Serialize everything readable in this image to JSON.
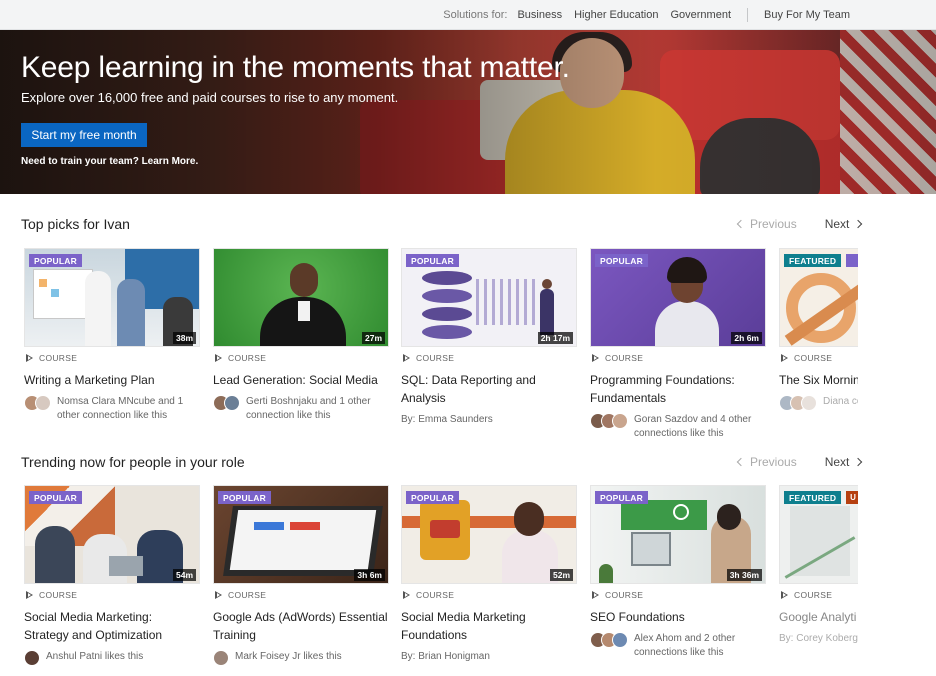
{
  "topbar": {
    "solutions_label": "Solutions for:",
    "links": [
      "Business",
      "Higher Education",
      "Government"
    ],
    "buy_label": "Buy For My Team"
  },
  "hero": {
    "headline": "Keep learning in the moments that matter.",
    "subheadline": "Explore over 16,000 free and paid courses to rise to any moment.",
    "cta_label": "Start my free month",
    "team_link": "Need to train your team? Learn More."
  },
  "pager": {
    "previous": "Previous",
    "next": "Next"
  },
  "sections": [
    {
      "title": "Top picks for Ivan",
      "cards": [
        {
          "badge": "POPULAR",
          "duration": "38m",
          "type": "COURSE",
          "title": "Writing a Marketing Plan",
          "meta": "Nomsa Clara MNcube and 1 other connection like this"
        },
        {
          "badge": "",
          "duration": "27m",
          "type": "COURSE",
          "title": "Lead Generation: Social Media",
          "meta": "Gerti Boshnjaku and 1 other connection like this"
        },
        {
          "badge": "POPULAR",
          "duration": "2h 17m",
          "type": "COURSE",
          "title": "SQL: Data Reporting and Analysis",
          "meta": "By: Emma Saunders"
        },
        {
          "badge": "POPULAR",
          "duration": "2h 6m",
          "type": "COURSE",
          "title": "Programming Foundations: Fundamentals",
          "meta": "Goran Sazdov and 4 other connections like this"
        },
        {
          "badge": "FEATURED",
          "duration": "",
          "type": "COURSE",
          "title": "The Six Mornin Performers",
          "meta": "Diana conne"
        }
      ]
    },
    {
      "title": "Trending now for people in your role",
      "cards": [
        {
          "badge": "POPULAR",
          "duration": "54m",
          "type": "COURSE",
          "title": "Social Media Marketing: Strategy and Optimization",
          "meta": "Anshul Patni likes this"
        },
        {
          "badge": "POPULAR",
          "duration": "3h 6m",
          "type": "COURSE",
          "title": "Google Ads (AdWords) Essential Training",
          "meta": "Mark Foisey Jr likes this"
        },
        {
          "badge": "POPULAR",
          "duration": "52m",
          "type": "COURSE",
          "title": "Social Media Marketing Foundations",
          "meta": "By: Brian Honigman"
        },
        {
          "badge": "POPULAR",
          "duration": "3h 36m",
          "type": "COURSE",
          "title": "SEO Foundations",
          "meta": "Alex Ahom and 2 other connections like this"
        },
        {
          "badge": "FEATURED",
          "badge2": "U",
          "duration": "",
          "type": "COURSE",
          "title": "Google Analyti Training",
          "meta": "By: Corey Koberg"
        }
      ]
    }
  ],
  "colors": {
    "brand_blue": "#0a66c2",
    "popular_badge": "#7b63c9",
    "featured_badge": "#0e7f8e"
  }
}
